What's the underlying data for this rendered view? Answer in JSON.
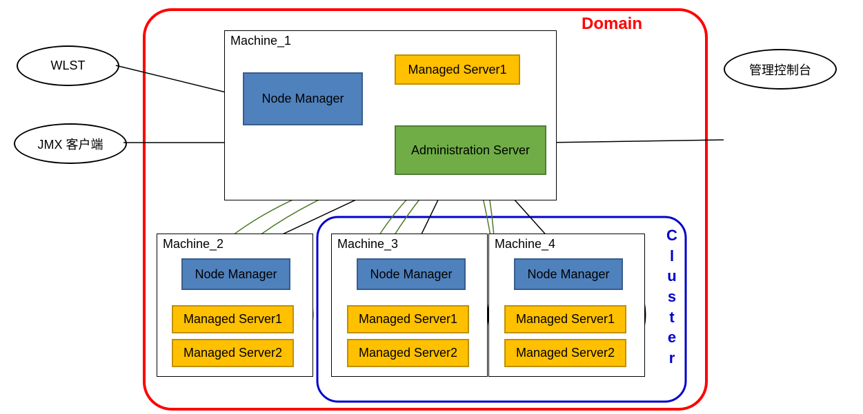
{
  "external": {
    "wlst": "WLST",
    "jmx_client": "JMX 客户端",
    "admin_console": "管理控制台"
  },
  "domain_label": "Domain",
  "cluster_label": "Cluster",
  "machine1": {
    "label": "Machine_1",
    "node_manager": "Node Manager",
    "managed_server1": "Managed Server1",
    "admin_server": "Administration Server"
  },
  "machine2": {
    "label": "Machine_2",
    "node_manager": "Node Manager",
    "managed_server1": "Managed Server1",
    "managed_server2": "Managed Server2"
  },
  "machine3": {
    "label": "Machine_3",
    "node_manager": "Node Manager",
    "managed_server1": "Managed Server1",
    "managed_server2": "Managed Server2"
  },
  "machine4": {
    "label": "Machine_4",
    "node_manager": "Node Manager",
    "managed_server1": "Managed Server1",
    "managed_server2": "Managed Server2"
  }
}
